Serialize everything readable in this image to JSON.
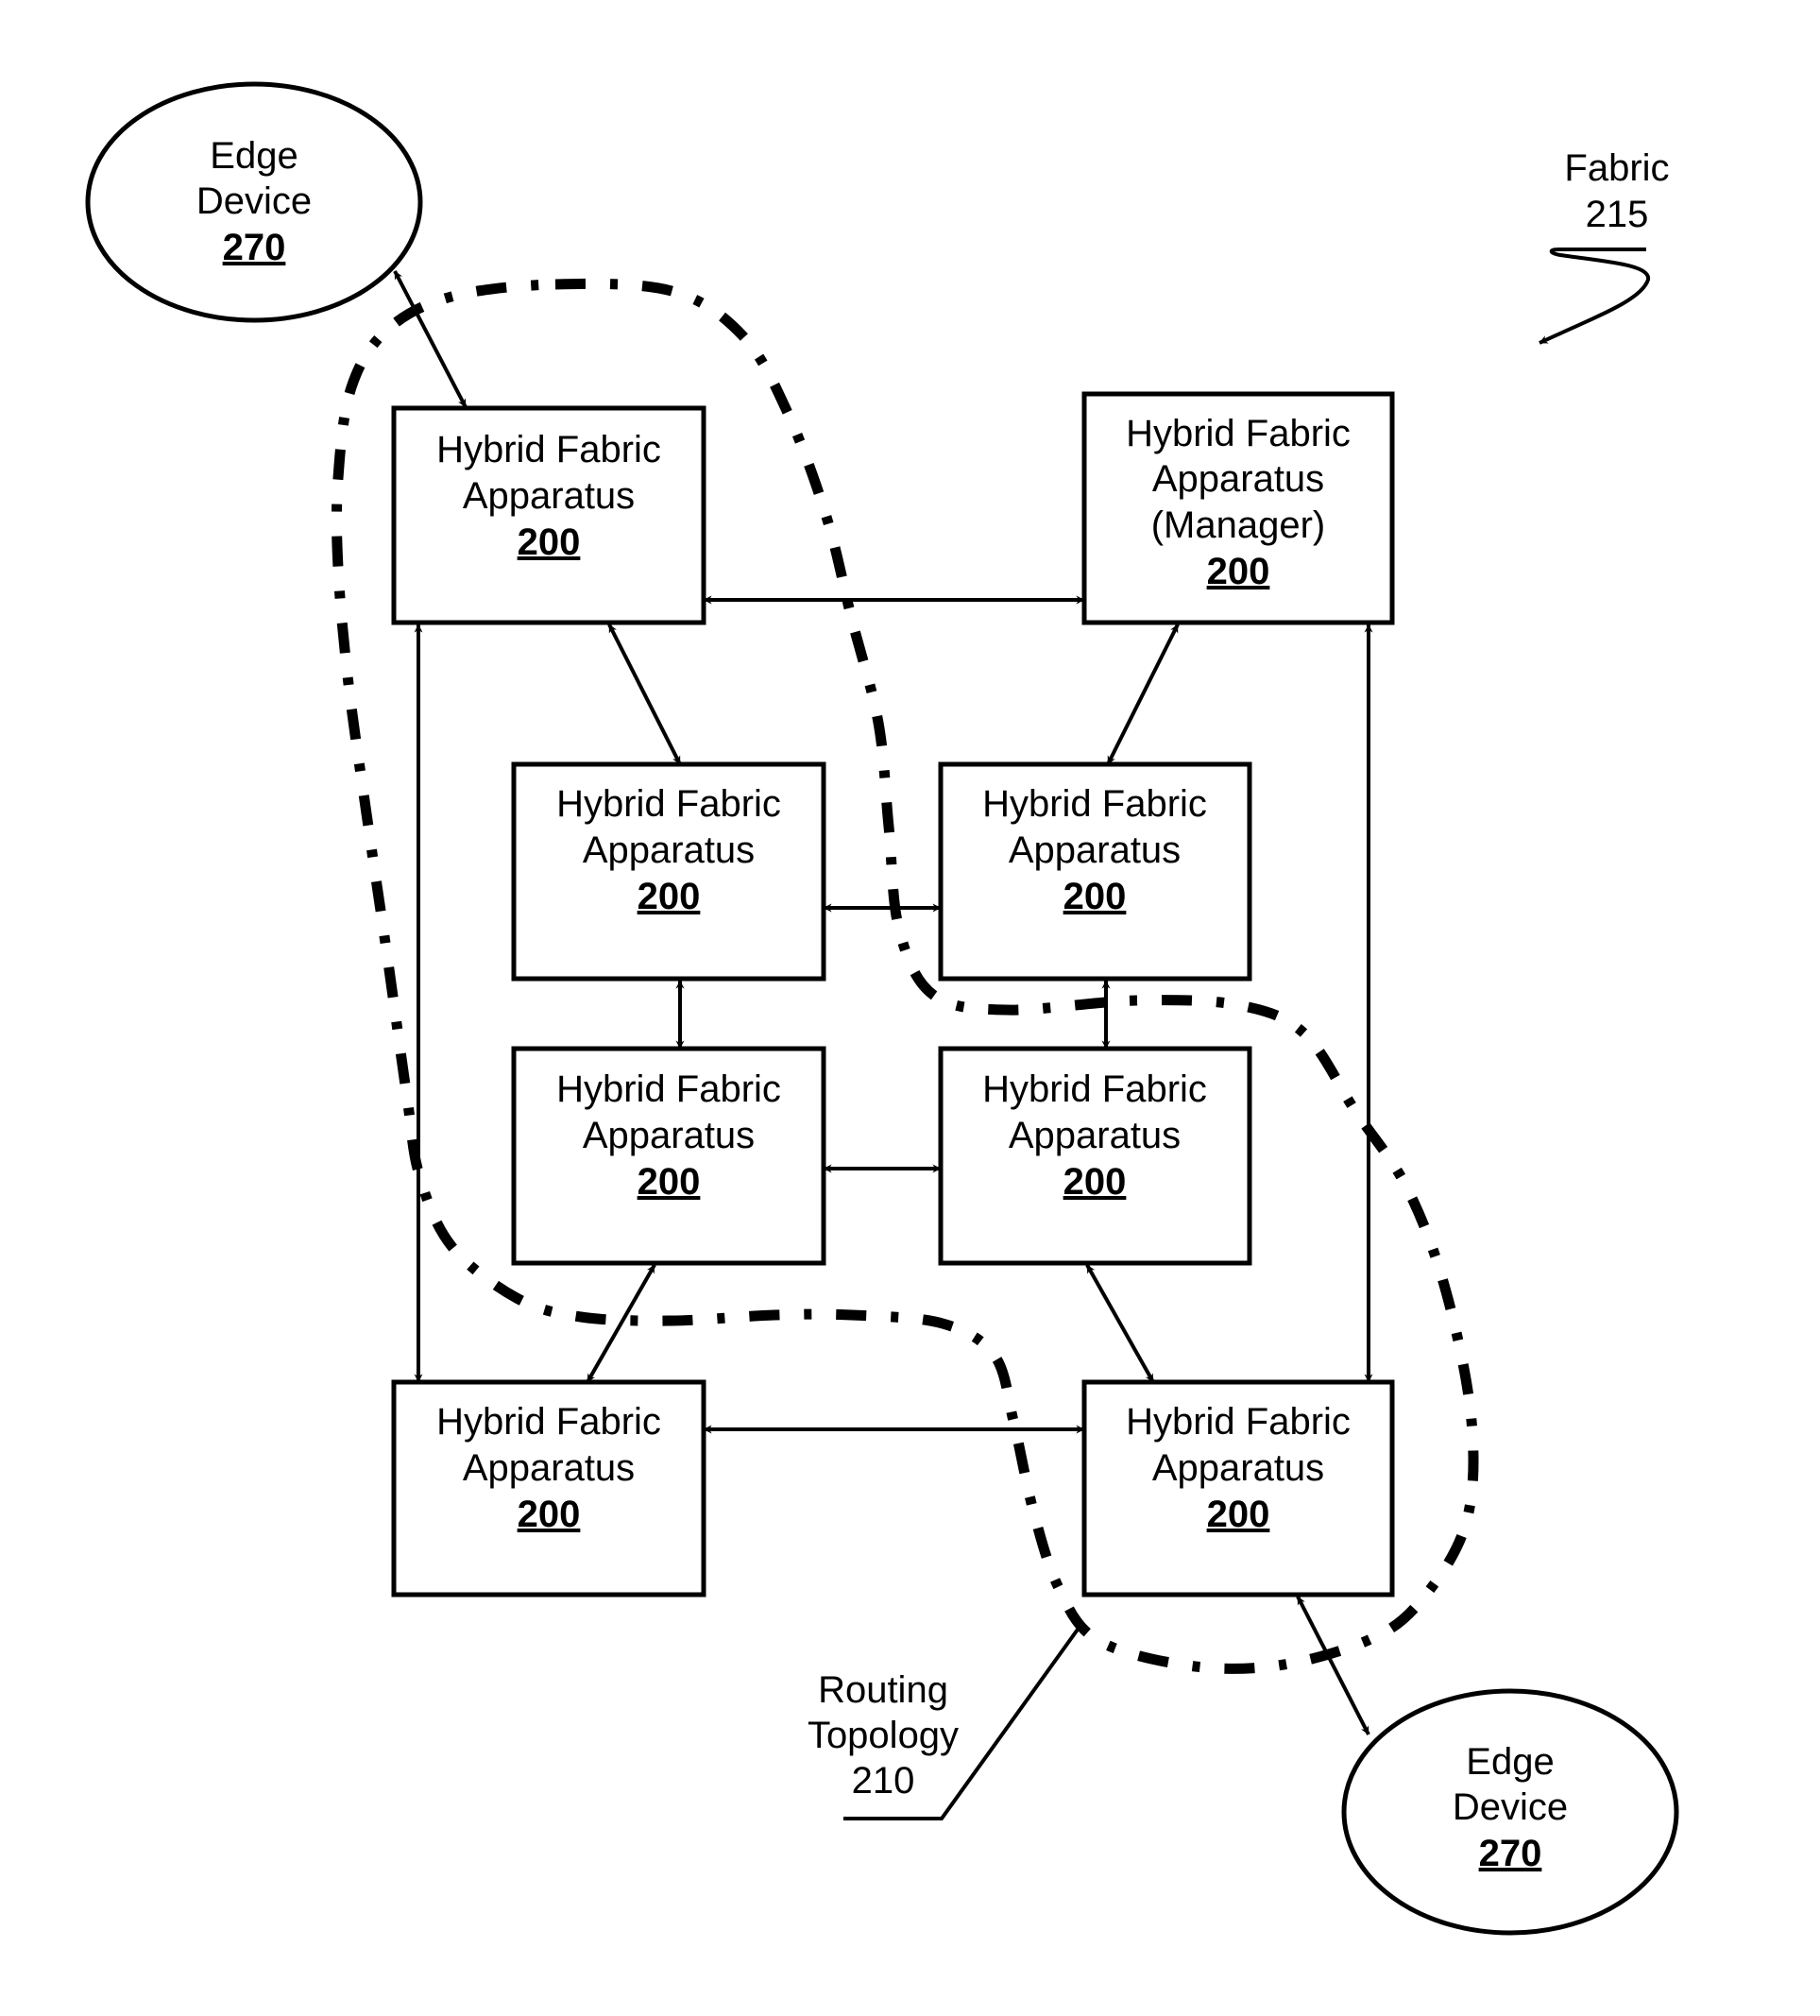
{
  "figure": {
    "fabric_label": {
      "line1": "Fabric",
      "line2": "215"
    },
    "routing_topology_label": {
      "line1": "Routing",
      "line2": "Topology",
      "line3": "210"
    },
    "edge_devices": [
      {
        "line1": "Edge",
        "line2": "Device",
        "ref": "270"
      },
      {
        "line1": "Edge",
        "line2": "Device",
        "ref": "270"
      }
    ],
    "apparatus": [
      {
        "id": "top-left",
        "line1": "Hybrid Fabric",
        "line2": "Apparatus",
        "ref": "200"
      },
      {
        "id": "top-right-manager",
        "line1": "Hybrid Fabric",
        "line2": "Apparatus",
        "line3": "(Manager)",
        "ref": "200"
      },
      {
        "id": "mid-upper-left",
        "line1": "Hybrid Fabric",
        "line2": "Apparatus",
        "ref": "200"
      },
      {
        "id": "mid-upper-right",
        "line1": "Hybrid Fabric",
        "line2": "Apparatus",
        "ref": "200"
      },
      {
        "id": "mid-lower-left",
        "line1": "Hybrid Fabric",
        "line2": "Apparatus",
        "ref": "200"
      },
      {
        "id": "mid-lower-right",
        "line1": "Hybrid Fabric",
        "line2": "Apparatus",
        "ref": "200"
      },
      {
        "id": "bottom-left",
        "line1": "Hybrid Fabric",
        "line2": "Apparatus",
        "ref": "200"
      },
      {
        "id": "bottom-right",
        "line1": "Hybrid Fabric",
        "line2": "Apparatus",
        "ref": "200"
      }
    ],
    "connections": [
      {
        "from": "edge-device-1",
        "to": "top-left",
        "type": "bidirectional"
      },
      {
        "from": "top-left",
        "to": "top-right-manager",
        "type": "bidirectional"
      },
      {
        "from": "top-left",
        "to": "bottom-left",
        "type": "bidirectional"
      },
      {
        "from": "top-right-manager",
        "to": "bottom-right",
        "type": "bidirectional"
      },
      {
        "from": "top-left",
        "to": "mid-upper-left",
        "type": "bidirectional"
      },
      {
        "from": "top-right-manager",
        "to": "mid-upper-right",
        "type": "bidirectional"
      },
      {
        "from": "mid-upper-left",
        "to": "mid-upper-right",
        "type": "bidirectional"
      },
      {
        "from": "mid-upper-left",
        "to": "mid-lower-left",
        "type": "bidirectional"
      },
      {
        "from": "mid-upper-right",
        "to": "mid-lower-right",
        "type": "bidirectional"
      },
      {
        "from": "mid-lower-left",
        "to": "mid-lower-right",
        "type": "bidirectional"
      },
      {
        "from": "mid-lower-left",
        "to": "bottom-left",
        "type": "bidirectional"
      },
      {
        "from": "mid-lower-right",
        "to": "bottom-right",
        "type": "bidirectional"
      },
      {
        "from": "bottom-left",
        "to": "bottom-right",
        "type": "bidirectional"
      },
      {
        "from": "bottom-right",
        "to": "edge-device-2",
        "type": "bidirectional"
      }
    ]
  }
}
